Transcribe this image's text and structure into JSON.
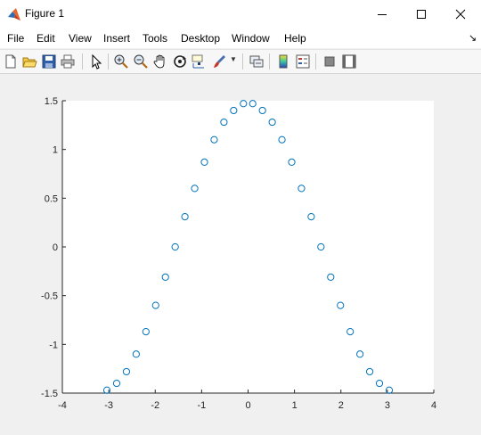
{
  "window": {
    "title": "Figure 1",
    "controls": [
      "minimize",
      "maximize",
      "close"
    ]
  },
  "menu": {
    "items": [
      "File",
      "Edit",
      "View",
      "Insert",
      "Tools",
      "Desktop",
      "Window",
      "Help"
    ],
    "overflow_icon": "dock-arrow-icon"
  },
  "toolbar": {
    "items": [
      "new-figure-icon",
      "open-file-icon",
      "save-icon",
      "print-icon",
      "select-arrow-icon",
      "zoom-in-icon",
      "zoom-out-icon",
      "pan-hand-icon",
      "rotate-3d-icon",
      "data-cursor-icon",
      "brush-icon",
      "brush-dropdown-icon",
      "link-plot-icon",
      "colorbar-icon",
      "legend-icon",
      "hide-plot-tools-icon",
      "show-plot-tools-icon"
    ]
  },
  "chart_data": {
    "type": "scatter",
    "title": "",
    "xlabel": "",
    "ylabel": "",
    "xlim": [
      -4,
      4
    ],
    "ylim": [
      -1.5,
      1.5
    ],
    "xticks": [
      "-4",
      "-3",
      "-2",
      "-1",
      "0",
      "1",
      "2",
      "3",
      "4"
    ],
    "yticks": [
      "1.5",
      "1",
      "0.5",
      "0",
      "-0.5",
      "-1",
      "-1.5"
    ],
    "marker": "o",
    "marker_color": "#0072bd",
    "grid": false,
    "series": [
      {
        "x": [
          -3.04,
          -2.83,
          -2.62,
          -2.41,
          -2.2,
          -1.99,
          -1.78,
          -1.57,
          -1.36,
          -1.15,
          -0.94,
          -0.73,
          -0.52,
          -0.31,
          -0.1,
          0.1,
          0.31,
          0.52,
          0.73,
          0.94,
          1.15,
          1.36,
          1.57,
          1.78,
          1.99,
          2.2,
          2.41,
          2.62,
          2.83,
          3.04
        ],
        "y": [
          -1.47,
          -1.4,
          -1.28,
          -1.1,
          -0.87,
          -0.6,
          -0.31,
          0.0,
          0.31,
          0.6,
          0.87,
          1.1,
          1.28,
          1.4,
          1.47,
          1.47,
          1.4,
          1.28,
          1.1,
          0.87,
          0.6,
          0.31,
          0.0,
          -0.31,
          -0.6,
          -0.87,
          -1.1,
          -1.28,
          -1.4,
          -1.47
        ]
      }
    ]
  }
}
